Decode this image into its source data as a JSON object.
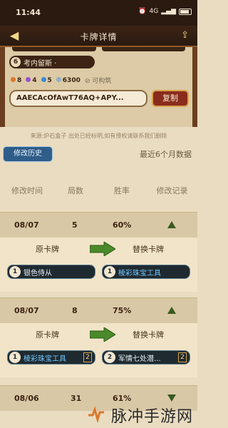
{
  "status": {
    "time": "11:44",
    "network": "4G"
  },
  "header": {
    "title": "卡牌详情"
  },
  "deck": {
    "hero_label": "考内留斯 ·",
    "hero_badge": "6",
    "dust": [
      {
        "color": "#d9782a",
        "value": "8"
      },
      {
        "color": "#9a4fd0",
        "value": "4"
      },
      {
        "color": "#3a8ad9",
        "value": "5"
      },
      {
        "color": "#8fb0c8",
        "value": "6300"
      }
    ],
    "craftable_label": "可构筑",
    "code": "AAECAcOfAwT76AQ+APY...",
    "copy_label": "复制",
    "source_note": "来源:炉石盒子 出处已经标明,如有侵权请联系我们删除"
  },
  "history": {
    "tab_label": "修改历史",
    "range_label": "最近6个月数据",
    "columns": [
      "修改时间",
      "局数",
      "胜率",
      "修改记录"
    ],
    "records": [
      {
        "date": "08/07",
        "games": "5",
        "winrate": "60%",
        "trend": "up",
        "from_label": "原卡牌",
        "to_label": "替换卡牌",
        "from_card": {
          "cost": "1",
          "name": "银色侍从",
          "count": "",
          "color": "#e6eef2"
        },
        "to_card": {
          "cost": "1",
          "name": "棱彩珠宝工具",
          "count": "",
          "color": "#6fc7ff"
        }
      },
      {
        "date": "08/07",
        "games": "8",
        "winrate": "75%",
        "trend": "up",
        "from_label": "原卡牌",
        "to_label": "替换卡牌",
        "from_card": {
          "cost": "1",
          "name": "棱彩珠宝工具",
          "count": "2",
          "color": "#6fc7ff"
        },
        "to_card": {
          "cost": "2",
          "name": "军情七处潜...",
          "count": "2",
          "color": "#e6eef2"
        }
      },
      {
        "date": "08/06",
        "games": "31",
        "winrate": "61%",
        "trend": "down"
      }
    ]
  },
  "watermark": "脉冲手游网"
}
